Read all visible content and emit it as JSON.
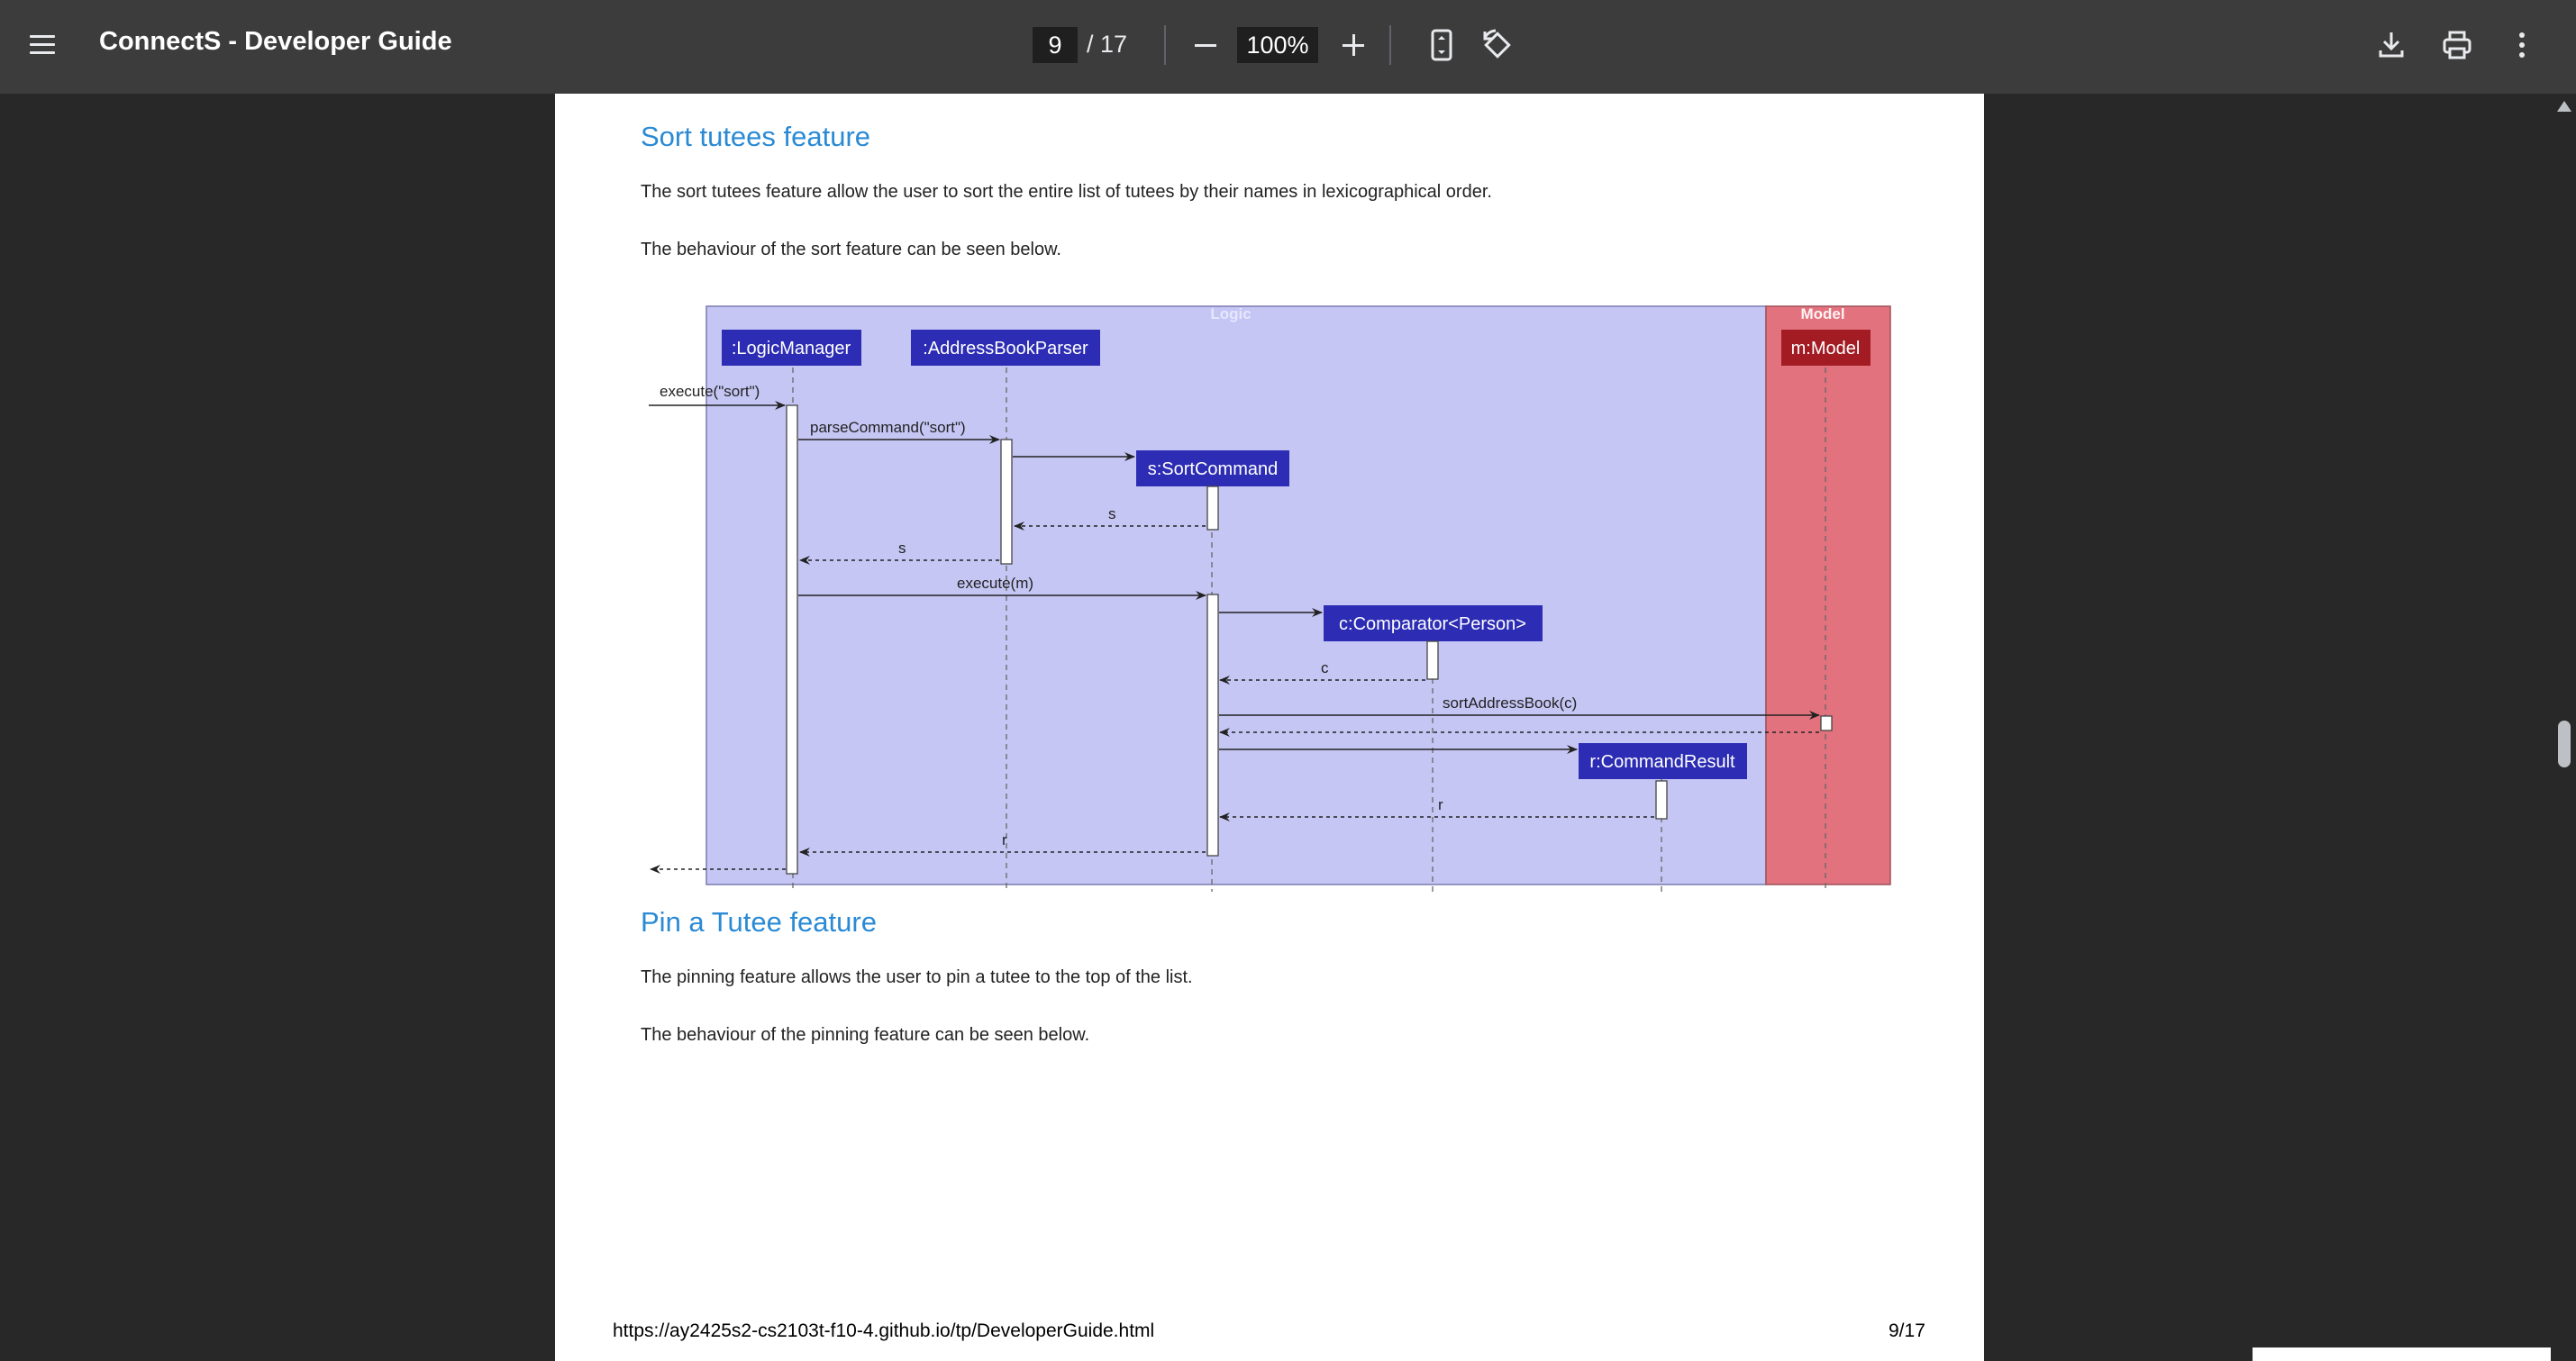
{
  "toolbar": {
    "menu_icon": "hamburger-menu-icon",
    "title": "ConnectS - Developer Guide",
    "current_page": "9",
    "total_pages": "/ 17",
    "zoom": "100%",
    "icons": [
      "minus-icon",
      "plus-icon",
      "fit-page-icon",
      "rotate-icon",
      "download-icon",
      "print-icon",
      "more-vert-icon"
    ]
  },
  "document": {
    "section1": {
      "title": "Sort tutees feature",
      "para1": "The sort tutees feature allow the user to sort the entire list of tutees by their names in lexicographical order.",
      "para2": "The behaviour of the sort feature can be seen below."
    },
    "diagram": {
      "logic_box": "Logic",
      "model_box": "Model",
      "participants": {
        "logic_manager": ":LogicManager",
        "parser": ":AddressBookParser",
        "sort_command": "s:SortCommand",
        "comparator": "c:Comparator<Person>",
        "command_result": "r:CommandResult",
        "model": "m:Model"
      },
      "messages": {
        "execute_sort": "execute(\"sort\")",
        "parse_command": "parseCommand(\"sort\")",
        "return_s1": "s",
        "return_s2": "s",
        "execute_m": "execute(m)",
        "return_c": "c",
        "sort_address_book": "sortAddressBook(c)",
        "return_r1": "r",
        "return_r2": "r"
      },
      "colors": {
        "logic_bg": "#c5c6f4",
        "model_bg": "#e2737e",
        "participant_logic": "#2c2cb4",
        "participant_model": "#a31c23"
      }
    },
    "section2": {
      "title": "Pin a Tutee feature",
      "para1": "The pinning feature allows the user to pin a tutee to the top of the list.",
      "para2": "The behaviour of the pinning feature can be seen below."
    },
    "footer": {
      "url": "https://ay2425s2-cs2103t-f10-4.github.io/tp/DeveloperGuide.html",
      "page": "9/17"
    }
  }
}
